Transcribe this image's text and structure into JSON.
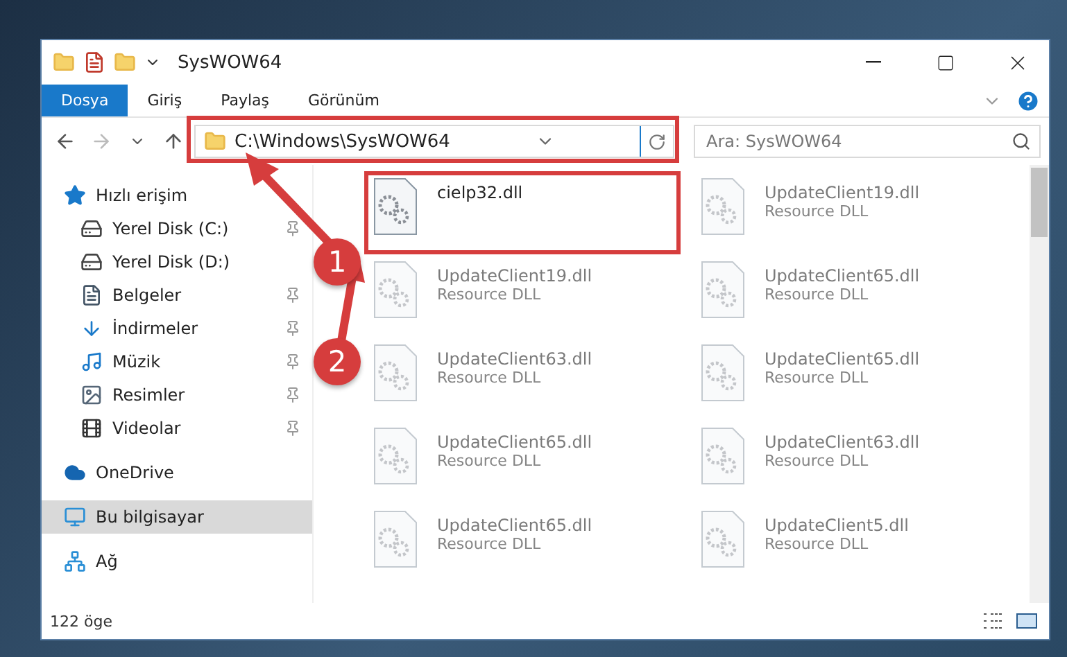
{
  "window": {
    "title": "SysWOW64"
  },
  "ribbon_tabs": [
    {
      "label": "Dosya",
      "selected": true
    },
    {
      "label": "Giriş",
      "selected": false
    },
    {
      "label": "Paylaş",
      "selected": false
    },
    {
      "label": "Görünüm",
      "selected": false
    }
  ],
  "address_bar": {
    "path": "C:\\Windows\\SysWOW64"
  },
  "search": {
    "placeholder": "Ara: SysWOW64"
  },
  "sidebar": {
    "items": [
      {
        "label": "Hızlı erişim",
        "kind": "star",
        "pinned": false,
        "selected": false,
        "children": [
          {
            "label": "Yerel Disk (C:)",
            "kind": "drive",
            "pinned": true,
            "selected": false
          },
          {
            "label": "Yerel Disk (D:)",
            "kind": "drive",
            "pinned": false,
            "selected": false
          },
          {
            "label": "Belgeler",
            "kind": "documents",
            "pinned": true,
            "selected": false
          },
          {
            "label": "İndirmeler",
            "kind": "download",
            "pinned": true,
            "selected": false
          },
          {
            "label": "Müzik",
            "kind": "music",
            "pinned": true,
            "selected": false
          },
          {
            "label": "Resimler",
            "kind": "pictures",
            "pinned": true,
            "selected": false
          },
          {
            "label": "Videolar",
            "kind": "video",
            "pinned": true,
            "selected": false
          }
        ]
      },
      {
        "label": "OneDrive",
        "kind": "cloud",
        "pinned": false,
        "selected": false
      },
      {
        "label": "Bu bilgisayar",
        "kind": "computer",
        "pinned": false,
        "selected": true
      },
      {
        "label": "Ağ",
        "kind": "network",
        "pinned": false,
        "selected": false
      }
    ]
  },
  "files": [
    {
      "name": "cielp32.dll",
      "highlighted": true
    },
    {
      "name": "UpdateClient19.dll",
      "type": "Resource DLL",
      "highlighted": false
    },
    {
      "name": "UpdateClient19.dll",
      "type": "Resource DLL",
      "highlighted": false
    },
    {
      "name": "UpdateClient65.dll",
      "type": "Resource DLL",
      "highlighted": false
    },
    {
      "name": "UpdateClient63.dll",
      "type": "Resource DLL",
      "highlighted": false
    },
    {
      "name": "UpdateClient65.dll",
      "type": "Resource DLL",
      "highlighted": false
    },
    {
      "name": "UpdateClient65.dll",
      "type": "Resource DLL",
      "highlighted": false
    },
    {
      "name": "UpdateClient63.dll",
      "type": "Resource DLL",
      "highlighted": false
    },
    {
      "name": "UpdateClient65.dll",
      "type": "Resource DLL",
      "highlighted": false
    },
    {
      "name": "UpdateClient5.dll",
      "type": "Resource DLL",
      "highlighted": false
    }
  ],
  "status_bar": {
    "item_count": "122 öge"
  },
  "annotations": [
    {
      "number": "1"
    },
    {
      "number": "2"
    }
  ]
}
